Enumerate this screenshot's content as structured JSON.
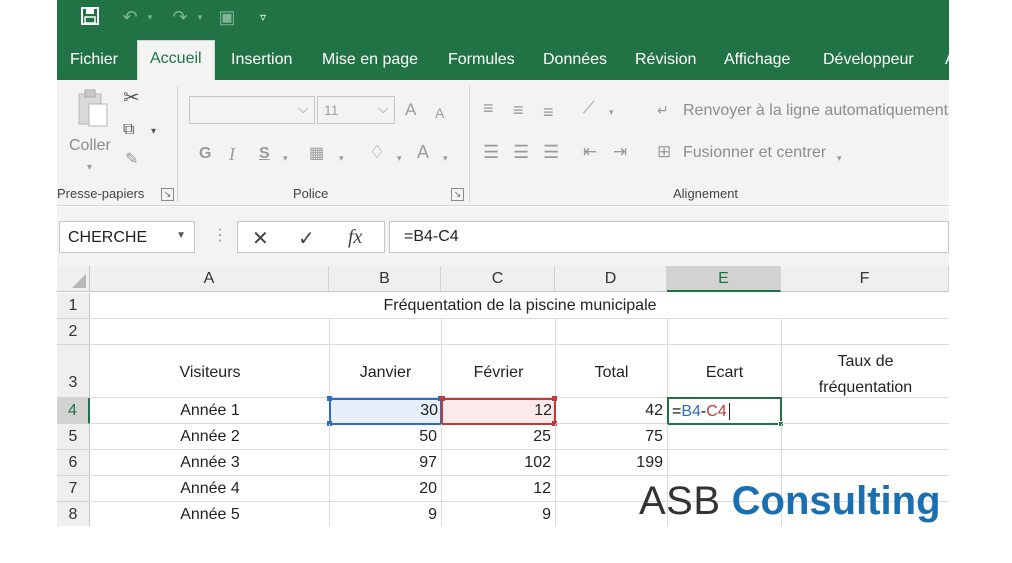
{
  "ribbon_tabs": [
    "Fichier",
    "Accueil",
    "Insertion",
    "Mise en page",
    "Formules",
    "Données",
    "Révision",
    "Affichage",
    "Développeur",
    "A"
  ],
  "active_tab": "Accueil",
  "ribbon": {
    "paste_label": "Coller",
    "clipboard_group": "Presse-papiers",
    "font_group": "Police",
    "font_size_value": "11",
    "bold": "G",
    "italic": "I",
    "underline": "S",
    "grow_font": "A",
    "shrink_font": "A",
    "font_color": "A",
    "alignment_group": "Alignement",
    "wrap_text": "Renvoyer à la ligne automatiquement",
    "merge_center": "Fusionner et centrer"
  },
  "formula_bar": {
    "name_box": "CHERCHE",
    "fx_label": "fx",
    "formula": "=B4-C4"
  },
  "columns": [
    "A",
    "B",
    "C",
    "D",
    "E",
    "F"
  ],
  "selected_column": "E",
  "rows": [
    "1",
    "2",
    "3",
    "4",
    "5",
    "6",
    "7",
    "8"
  ],
  "selected_row": "4",
  "sheet": {
    "title": "Fréquentation de la piscine municipale",
    "headers": {
      "A": "Visiteurs",
      "B": "Janvier",
      "C": "Février",
      "D": "Total",
      "E": "Ecart",
      "F_line1": "Taux de",
      "F_line2": "fréquentation"
    },
    "data": [
      {
        "A": "Année 1",
        "B": "30",
        "C": "12",
        "D": "42"
      },
      {
        "A": "Année 2",
        "B": "50",
        "C": "25",
        "D": "75"
      },
      {
        "A": "Année 3",
        "B": "97",
        "C": "102",
        "D": "199"
      },
      {
        "A": "Année 4",
        "B": "20",
        "C": "12",
        "D": ""
      },
      {
        "A": "Année 5",
        "B": "9",
        "C": "9",
        "D": ""
      }
    ],
    "edit_cell": {
      "prefix": "=",
      "ref1": "B4",
      "op": "-",
      "ref2": "C4"
    }
  },
  "watermark": {
    "part1": "ASB",
    "part2": "Consulting"
  },
  "colors": {
    "excel_green": "#217346",
    "ref_blue": "#2d6cc0",
    "ref_red": "#c0393b",
    "brand_blue": "#1a6fb0"
  }
}
